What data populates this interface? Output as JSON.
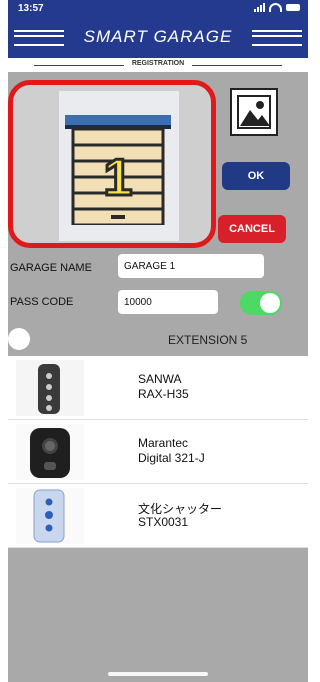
{
  "status": {
    "time": "13:57"
  },
  "header": {
    "title": "SMART GARAGE",
    "subtitle": "REGISTRATION"
  },
  "photo": {
    "garage_number": "1"
  },
  "buttons": {
    "ok": "OK",
    "cancel": "CANCEL"
  },
  "form": {
    "garage_name_label": "GARAGE NAME",
    "garage_name_value": "GARAGE 1",
    "pass_code_label": "PASS CODE",
    "pass_code_value": "10000",
    "toggle_on": true
  },
  "extension": {
    "label": "EXTENSION 5"
  },
  "remotes": [
    {
      "brand": "SANWA",
      "model": "RAX-H35"
    },
    {
      "brand": "Marantec",
      "model": "Digital 321-J"
    },
    {
      "brand": "文化シャッター",
      "model": "STX0031"
    }
  ],
  "colors": {
    "header": "#243a8e",
    "ok": "#203a86",
    "cancel": "#d7202a",
    "toggle": "#4cd964",
    "highlight": "#e01a1a"
  }
}
